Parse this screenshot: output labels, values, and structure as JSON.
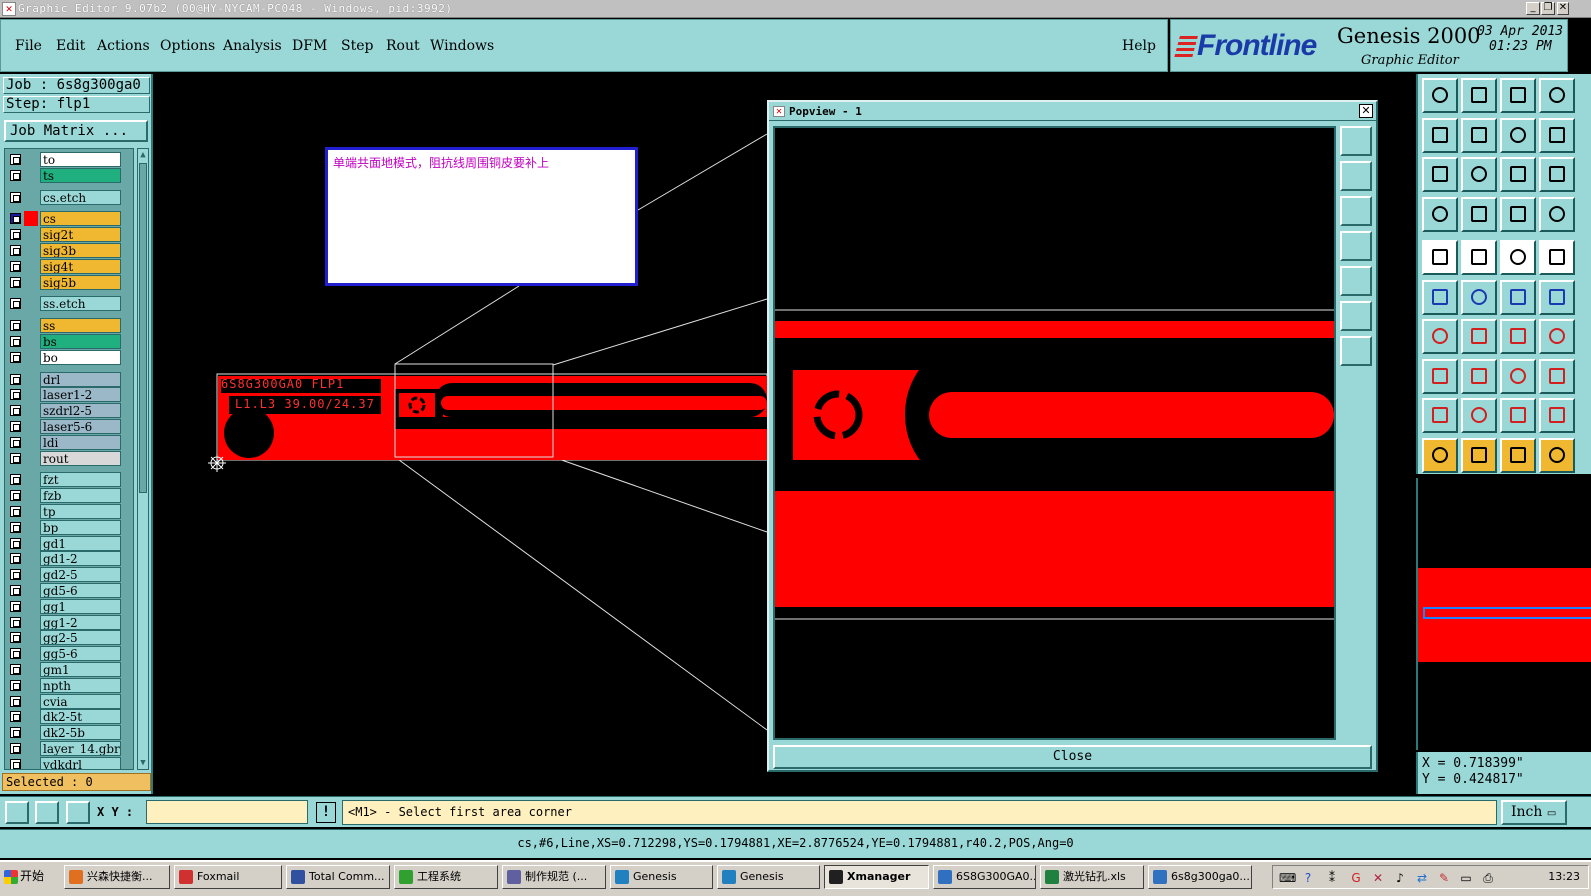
{
  "window": {
    "title": "Graphic Editor 9.07b2 (00@HY-NYCAM-PC048 - Windows, pid:3992)"
  },
  "menu": {
    "items": [
      "File",
      "Edit",
      "Actions",
      "Options",
      "Analysis",
      "DFM",
      "Step",
      "Rout",
      "Windows"
    ],
    "help": "Help"
  },
  "brand": {
    "logo": "Frontline",
    "product": "Genesis 2000",
    "subtitle": "Graphic Editor",
    "date": "03 Apr 2013",
    "time": "01:23 PM"
  },
  "job": {
    "job_label": "Job : 6s8g300ga0",
    "step_label": "Step: flp1",
    "matrix_button": "Job Matrix ..."
  },
  "layers": [
    {
      "name": "to",
      "color": "#ffffff"
    },
    {
      "name": "ts",
      "color": "#20b080"
    },
    {
      "name": "cs.etch",
      "color": "#9ad8d8"
    },
    {
      "name": "cs",
      "color": "#f0b830",
      "active": true
    },
    {
      "name": "sig2t",
      "color": "#f0b830"
    },
    {
      "name": "sig3b",
      "color": "#f0b830"
    },
    {
      "name": "sig4t",
      "color": "#f0b830"
    },
    {
      "name": "sig5b",
      "color": "#f0b830"
    },
    {
      "name": "ss.etch",
      "color": "#9ad8d8"
    },
    {
      "name": "ss",
      "color": "#f0b830"
    },
    {
      "name": "bs",
      "color": "#20b080"
    },
    {
      "name": "bo",
      "color": "#ffffff"
    },
    {
      "name": "drl",
      "color": "#9ab8c8"
    },
    {
      "name": "laser1-2",
      "color": "#9ab8c8"
    },
    {
      "name": "szdrl2-5",
      "color": "#9ab8c8"
    },
    {
      "name": "laser5-6",
      "color": "#9ab8c8"
    },
    {
      "name": "ldi",
      "color": "#9ab8c8"
    },
    {
      "name": "rout",
      "color": "#d8d8d8"
    },
    {
      "name": "fzt",
      "color": "#9ad8d8"
    },
    {
      "name": "fzb",
      "color": "#9ad8d8"
    },
    {
      "name": "tp",
      "color": "#9ad8d8"
    },
    {
      "name": "bp",
      "color": "#9ad8d8"
    },
    {
      "name": "gd1",
      "color": "#9ad8d8"
    },
    {
      "name": "gd1-2",
      "color": "#9ad8d8"
    },
    {
      "name": "gd2-5",
      "color": "#9ad8d8"
    },
    {
      "name": "gd5-6",
      "color": "#9ad8d8"
    },
    {
      "name": "gg1",
      "color": "#9ad8d8"
    },
    {
      "name": "gg1-2",
      "color": "#9ad8d8"
    },
    {
      "name": "gg2-5",
      "color": "#9ad8d8"
    },
    {
      "name": "gg5-6",
      "color": "#9ad8d8"
    },
    {
      "name": "gm1",
      "color": "#9ad8d8"
    },
    {
      "name": "npth",
      "color": "#9ad8d8"
    },
    {
      "name": "cvia",
      "color": "#9ad8d8"
    },
    {
      "name": "dk2-5t",
      "color": "#9ad8d8"
    },
    {
      "name": "dk2-5b",
      "color": "#9ad8d8"
    },
    {
      "name": "layer_14.gbr",
      "color": "#9ad8d8"
    },
    {
      "name": "ydkdrl",
      "color": "#9ad8d8"
    }
  ],
  "selected": "Selected : 0",
  "note": "单端共面地模式，阻抗线周围铜皮要补上",
  "board_text": {
    "line1": "6S8G300GA0 FLP1",
    "line2": "L1.L3 39.00/24.37"
  },
  "popview": {
    "title": "Popview - 1",
    "close_label": "Close"
  },
  "coords": {
    "x": "X = 0.718399\"",
    "y": "Y = 0.424817\""
  },
  "command": {
    "xy_label": "X Y :",
    "xy_value": "",
    "prompt": "<M1> - Select first area corner",
    "unit": "Inch"
  },
  "status": "cs,#6,Line,XS=0.712298,YS=0.1794881,XE=2.8776524,YE=0.1794881,r40.2,POS,Ang=0",
  "taskbar": {
    "start": "开始",
    "tasks": [
      {
        "label": "兴森快捷衡...",
        "icon": "#e07020"
      },
      {
        "label": "Foxmail",
        "icon": "#d03030"
      },
      {
        "label": "Total Comm...",
        "icon": "#3050a0"
      },
      {
        "label": "工程系统",
        "icon": "#30a030"
      },
      {
        "label": "制作规范 (...",
        "icon": "#6060a0"
      },
      {
        "label": "Genesis",
        "icon": "#2080c0"
      },
      {
        "label": "Genesis",
        "icon": "#2080c0"
      },
      {
        "label": "Xmanager",
        "icon": "#202020",
        "active": true
      },
      {
        "label": "6S8G300GA0...",
        "icon": "#3070c0"
      },
      {
        "label": "激光钻孔.xls",
        "icon": "#208040"
      },
      {
        "label": "6s8g300ga0...",
        "icon": "#3070c0"
      }
    ],
    "clock": "13:23"
  },
  "colors": {
    "panel": "#9ad8d8",
    "copper": "#ff0000",
    "highlight": "#f0b830"
  }
}
